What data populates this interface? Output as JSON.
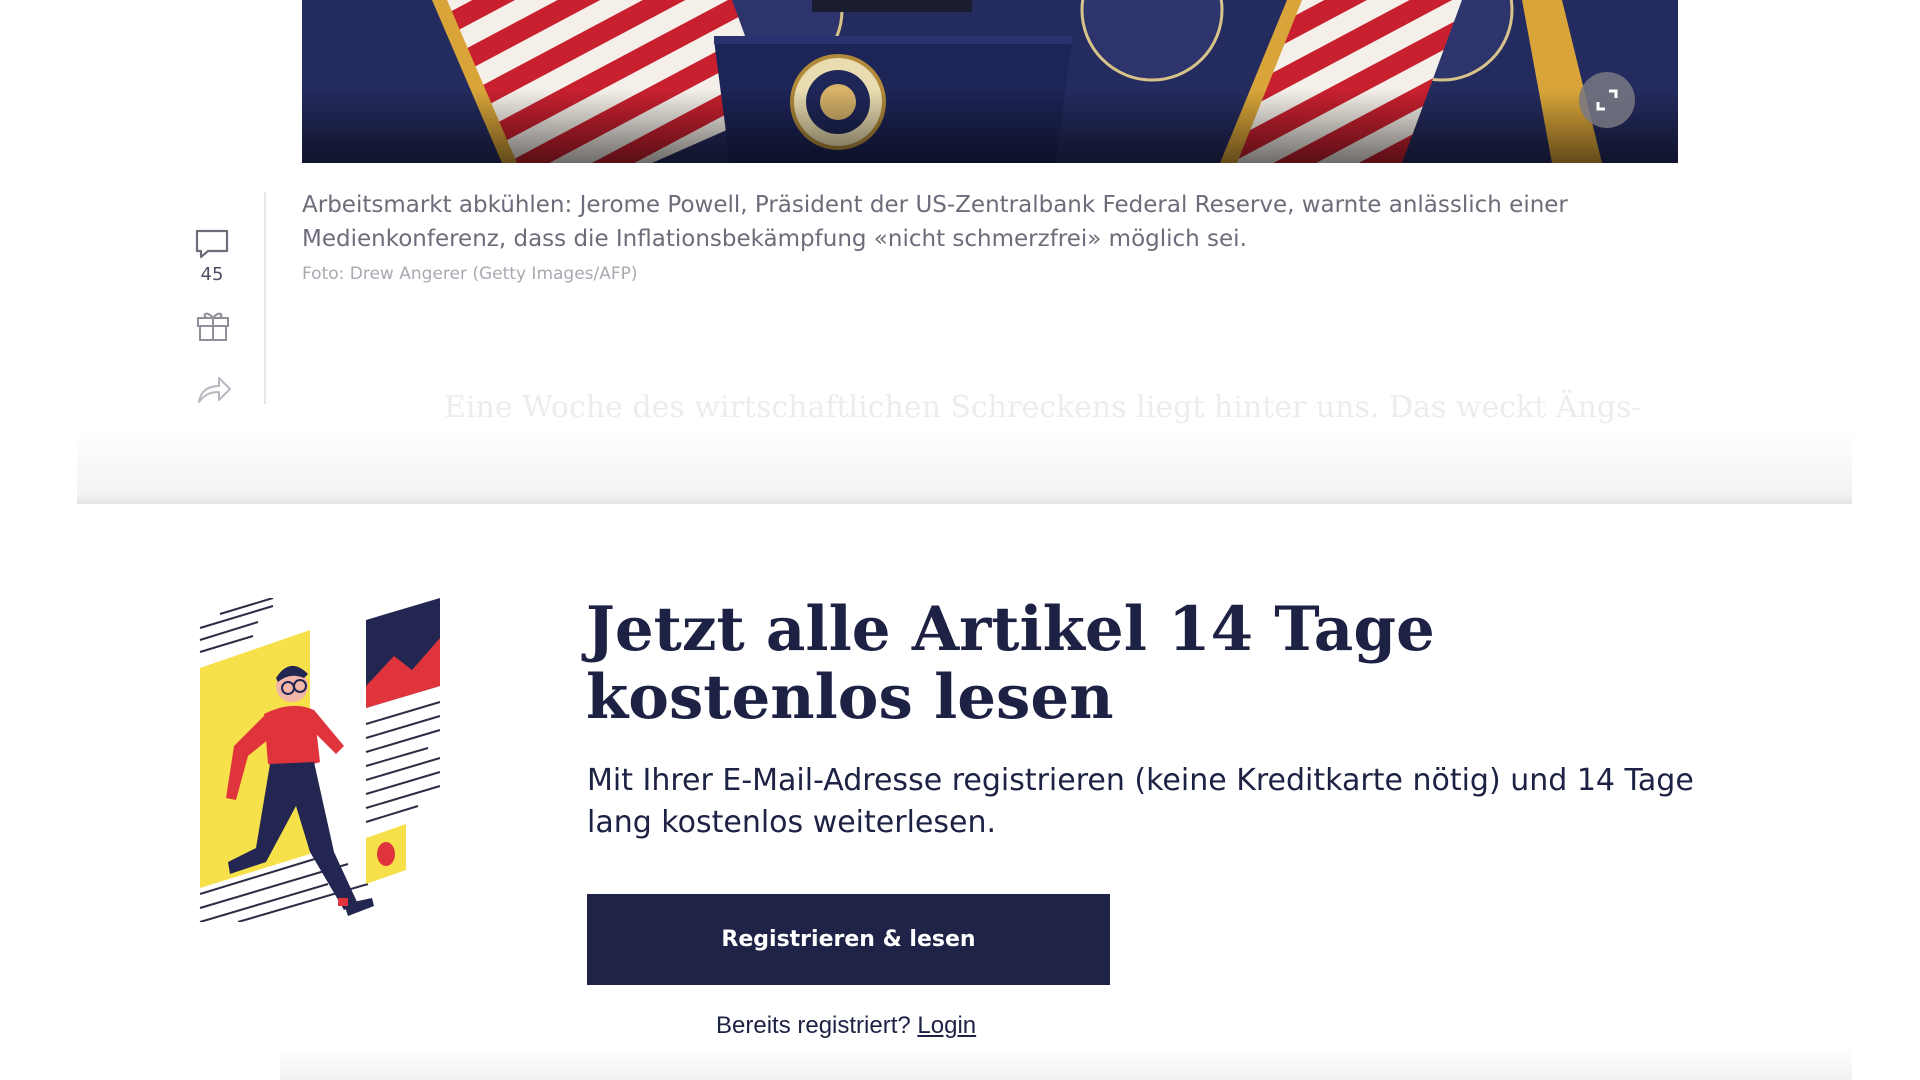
{
  "article": {
    "caption": "Arbeitsmarkt abkühlen: Jerome Powell, Präsident der US-Zentralbank Federal Reserve, warnte anlässlich einer Medienkonferenz, dass die Inflationsbekämpfung «nicht schmerzfrei» möglich sei.",
    "photo_credit": "Foto: Drew Angerer (Getty Images/AFP)",
    "teaser_faded": "Eine Woche des wirtschaftlichen Schreckens liegt hinter uns. Das weckt Ängs-"
  },
  "rail": {
    "comment_count": "45",
    "icons": [
      "comment-icon",
      "gift-icon",
      "share-icon"
    ]
  },
  "paywall": {
    "title": "Jetzt alle Artikel 14 Tage kostenlos lesen",
    "text": "Mit Ihrer E-Mail-Adresse registrieren (keine Kreditkarte nötig) und 14 Tage lang kostenlos weiterlesen.",
    "button_label": "Registrieren & lesen",
    "login_prompt": "Bereits registriert?",
    "login_label": "Login"
  },
  "colors": {
    "brand_navy": "#1f2347",
    "text_muted": "#6b6d7a",
    "illustration_yellow": "#f7e14a",
    "illustration_red": "#e0343c"
  }
}
